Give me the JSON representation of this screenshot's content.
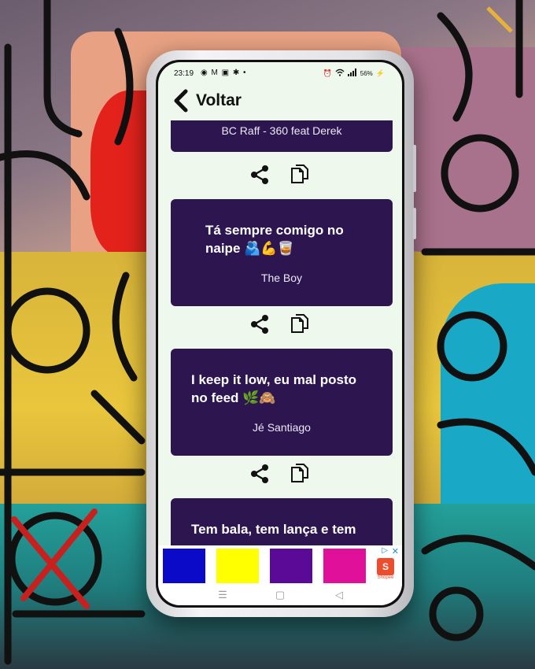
{
  "status_bar": {
    "time": "23:19",
    "app_icons": [
      "whatsapp-icon",
      "gmail-icon",
      "notification-icon",
      "accessibility-icon",
      "dot-icon"
    ],
    "battery": "56%",
    "right_icons": [
      "alarm-icon",
      "wifi-icon",
      "signal-icon",
      "battery-icon"
    ]
  },
  "header": {
    "back_label": "Voltar"
  },
  "quotes": [
    {
      "text": "",
      "author": "BC Raff - 360 feat Derek"
    },
    {
      "text": "Tá sempre comigo no naipe 🫂💪🥃",
      "author": "The Boy"
    },
    {
      "text": "I keep it low, eu mal posto no feed 🌿🙈",
      "author": "Jé Santiago"
    },
    {
      "text": "Tem bala, tem lança e tem",
      "author": ""
    }
  ],
  "actions": {
    "share_icon": "share-icon",
    "copy_icon": "copy-icon"
  },
  "ad": {
    "tiles": [
      "#0a0ac8",
      "#ffff00",
      "#5a0a96",
      "#e0109a"
    ],
    "brand": "Shopee",
    "close": "✕",
    "info": "▷"
  },
  "nav": {
    "recents": "☰",
    "home": "▢",
    "back": "◁"
  },
  "colors": {
    "card_bg": "#2d1650",
    "screen_bg": "#eef8ec",
    "text_dark": "#111111"
  }
}
